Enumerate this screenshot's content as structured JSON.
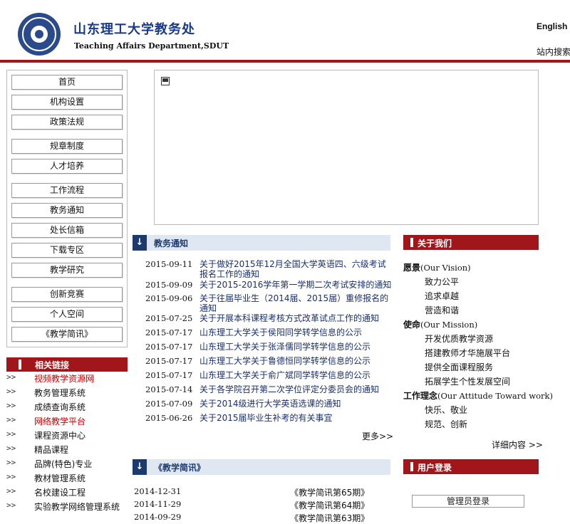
{
  "header": {
    "title": "山东理工大学教务处",
    "subtitle": "Teaching Affairs Department,SDUT",
    "lang_link": "English",
    "site_search": "站内搜索",
    "accent": "#a0161b"
  },
  "nav": {
    "items": [
      "首页",
      "机构设置",
      "政策法规",
      "规章制度",
      "人才培养",
      "工作流程",
      "教务通知",
      "处长信箱",
      "下载专区",
      "教学研究",
      "创新竞赛",
      "个人空间",
      "《教学简讯》"
    ]
  },
  "links": {
    "title": "相关链接",
    "arrow": ">>",
    "items": [
      {
        "label": "视频教学资源网",
        "highlight": true
      },
      {
        "label": "教务管理系统",
        "highlight": false
      },
      {
        "label": "成绩查询系统",
        "highlight": false
      },
      {
        "label": "网络教学平台",
        "highlight": true
      },
      {
        "label": "课程资源中心",
        "highlight": false
      },
      {
        "label": "精品课程",
        "highlight": false
      },
      {
        "label": "品牌(特色)专业",
        "highlight": false
      },
      {
        "label": "教材管理系统",
        "highlight": false
      },
      {
        "label": "名校建设工程",
        "highlight": false
      },
      {
        "label": "实验教学网络管理系统",
        "highlight": false
      }
    ]
  },
  "notices": {
    "title": "教务通知",
    "more": "更多>>",
    "items": [
      {
        "date": "2015-09-11",
        "title": "关于做好2015年12月全国大学英语四、六级考试报名工作的通知"
      },
      {
        "date": "2015-09-09",
        "title": "关于2015-2016学年第一学期二次考试安排的通知"
      },
      {
        "date": "2015-09-06",
        "title": "关于往届毕业生（2014届、2015届）重修报名的通知"
      },
      {
        "date": "2015-07-25",
        "title": "关于开展本科课程考核方式改革试点工作的通知"
      },
      {
        "date": "2015-07-17",
        "title": "山东理工大学关于侯阳同学转学信息的公示"
      },
      {
        "date": "2015-07-17",
        "title": "山东理工大学关于张泽儒同学转学信息的公示"
      },
      {
        "date": "2015-07-17",
        "title": "山东理工大学关于鲁德恒同学转学信息的公示"
      },
      {
        "date": "2015-07-17",
        "title": "山东理工大学关于俞广斌同学转学信息的公示"
      },
      {
        "date": "2015-07-14",
        "title": "关于各学院召开第二次学位评定分委员会的通知"
      },
      {
        "date": "2015-07-09",
        "title": "关于2014级进行大学英语选课的通知"
      },
      {
        "date": "2015-06-26",
        "title": "关于2015届毕业生补考的有关事宜"
      }
    ]
  },
  "brief": {
    "title": "《教学简讯》",
    "items": [
      {
        "date": "2014-12-31",
        "title": "《教学简讯第65期》"
      },
      {
        "date": "2014-11-29",
        "title": "《教学简讯第64期》"
      },
      {
        "date": "2014-09-29",
        "title": "《教学简讯第63期》"
      }
    ]
  },
  "about": {
    "title": "关于我们",
    "vision_cn": "愿景",
    "vision_en": "(Our Vision)",
    "vision_items": [
      "致力公平",
      "追求卓越",
      "营造和谐"
    ],
    "mission_cn": "使命",
    "mission_en": "(Our Mission)",
    "mission_items": [
      "开发优质教学资源",
      "搭建教师才华施展平台",
      "提供全面课程服务",
      "拓展学生个性发展空间"
    ],
    "attitude_cn": "工作理念",
    "attitude_en": "(Our Attitude Toward work)",
    "attitude_items": [
      "快乐、敬业",
      "规范、创新"
    ],
    "more": "详细内容 >>"
  },
  "login": {
    "title": "用户登录",
    "admin_button": "管理员登录"
  }
}
